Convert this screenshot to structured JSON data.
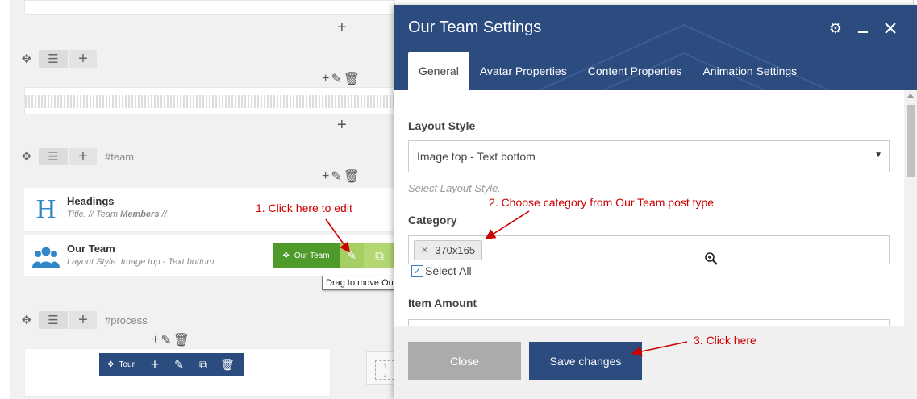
{
  "builder": {
    "rows": [
      {
        "tag": ""
      },
      {
        "tag": "#team"
      },
      {
        "tag": "#process"
      }
    ],
    "headings_element": {
      "title": "Headings",
      "subtitle_prefix": "Title: //",
      "subtitle_normal": " Team ",
      "subtitle_bold": "Members",
      "subtitle_suffix": " //"
    },
    "team_element": {
      "title": "Our Team",
      "subtitle": "Layout Style: Image top - Text bottom",
      "bar_label": "Our Team"
    },
    "tooltip": "Drag to move Our Team",
    "tour_bar_label": "Tour"
  },
  "annotations": {
    "step1": "1. Click here to edit",
    "step2": "2. Choose category from Our Team post type",
    "step3": "3. Click here"
  },
  "modal": {
    "title": "Our Team Settings",
    "tabs": [
      {
        "label": "General",
        "active": true
      },
      {
        "label": "Avatar Properties",
        "active": false
      },
      {
        "label": "Content Properties",
        "active": false
      },
      {
        "label": "Animation Settings",
        "active": false
      }
    ],
    "layout_style": {
      "label": "Layout Style",
      "value": "Image top - Text bottom",
      "help": "Select Layout Style."
    },
    "category": {
      "label": "Category",
      "tag": "370x165",
      "select_all": "Select All"
    },
    "item_amount": {
      "label": "Item Amount"
    },
    "buttons": {
      "close": "Close",
      "save": "Save changes"
    }
  },
  "colors": {
    "header": "#2c4b7f",
    "annotation": "#cc0000",
    "green_bar": "#4e9a2a",
    "tour_bar": "#2b4c7e"
  }
}
